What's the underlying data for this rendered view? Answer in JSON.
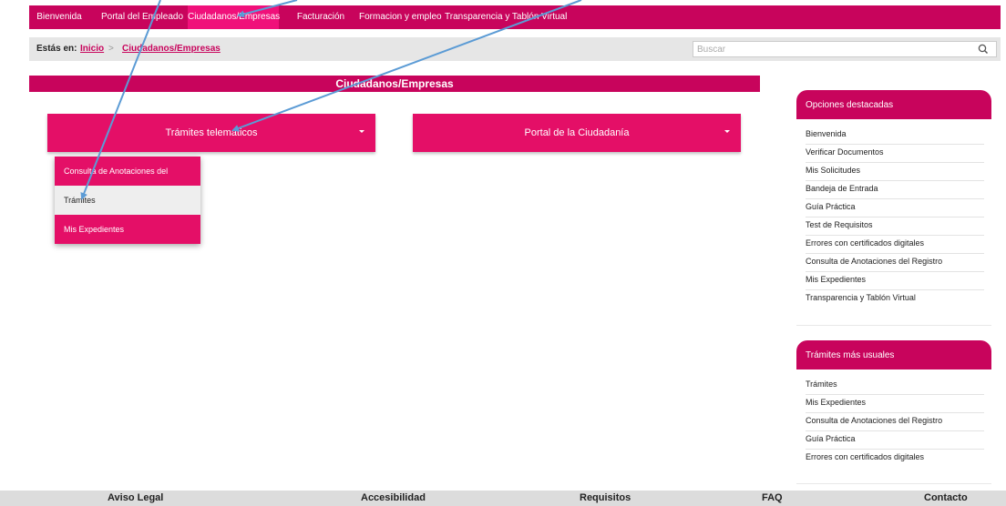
{
  "topnav": {
    "items": [
      {
        "label": "Bienvenida"
      },
      {
        "label": "Portal del Empleado"
      },
      {
        "label": "Ciudadanos/Empresas"
      },
      {
        "label": "Facturación"
      },
      {
        "label": "Formacion y empleo"
      },
      {
        "label": "Transparencia y Tablón Virtual"
      }
    ],
    "active_label": "Ciudadanos/Empresas"
  },
  "breadcrumb": {
    "prefix": "Estás en:",
    "items": [
      {
        "label": "Inicio"
      },
      {
        "label": "Ciudadanos/Empresas"
      }
    ],
    "separator": ">"
  },
  "search": {
    "placeholder": "Buscar",
    "icon": "magnifier-icon"
  },
  "main": {
    "title": "Ciudadanos/Empresas",
    "buttons": [
      {
        "label": "Trámites telemáticos"
      },
      {
        "label": "Portal de la Ciudadanía"
      }
    ],
    "dropdown": {
      "items": [
        {
          "label": "Consulta de Anotaciones del Registro"
        },
        {
          "label": "Trámites"
        },
        {
          "label": "Mis Expedientes"
        }
      ],
      "hovered": "Trámites"
    }
  },
  "sidebar": {
    "featured": {
      "title": "Opciones destacadas",
      "items": [
        {
          "label": "Bienvenida"
        },
        {
          "label": "Verificar Documentos"
        },
        {
          "label": "Mis Solicitudes"
        },
        {
          "label": "Bandeja de Entrada"
        },
        {
          "label": "Guía Práctica"
        },
        {
          "label": "Test de Requisitos"
        },
        {
          "label": "Errores con certificados digitales"
        },
        {
          "label": "Consulta de Anotaciones del Registro"
        },
        {
          "label": "Mis Expedientes"
        },
        {
          "label": "Transparencia y Tablón Virtual"
        }
      ]
    },
    "common": {
      "title": "Trámites más usuales",
      "items": [
        {
          "label": "Trámites"
        },
        {
          "label": "Mis Expedientes"
        },
        {
          "label": "Consulta de Anotaciones del Registro"
        },
        {
          "label": "Guía Práctica"
        },
        {
          "label": "Errores con certificados digitales"
        }
      ]
    }
  },
  "footer": {
    "links": [
      {
        "label": "Aviso Legal"
      },
      {
        "label": "Accesibilidad"
      },
      {
        "label": "Requisitos"
      },
      {
        "label": "FAQ"
      },
      {
        "label": "Contacto"
      }
    ]
  },
  "colors": {
    "brand": "#c8045c",
    "button": "#e40f67",
    "active_tab": "#f0107a",
    "annotation_arrow": "#5b9bd5"
  }
}
